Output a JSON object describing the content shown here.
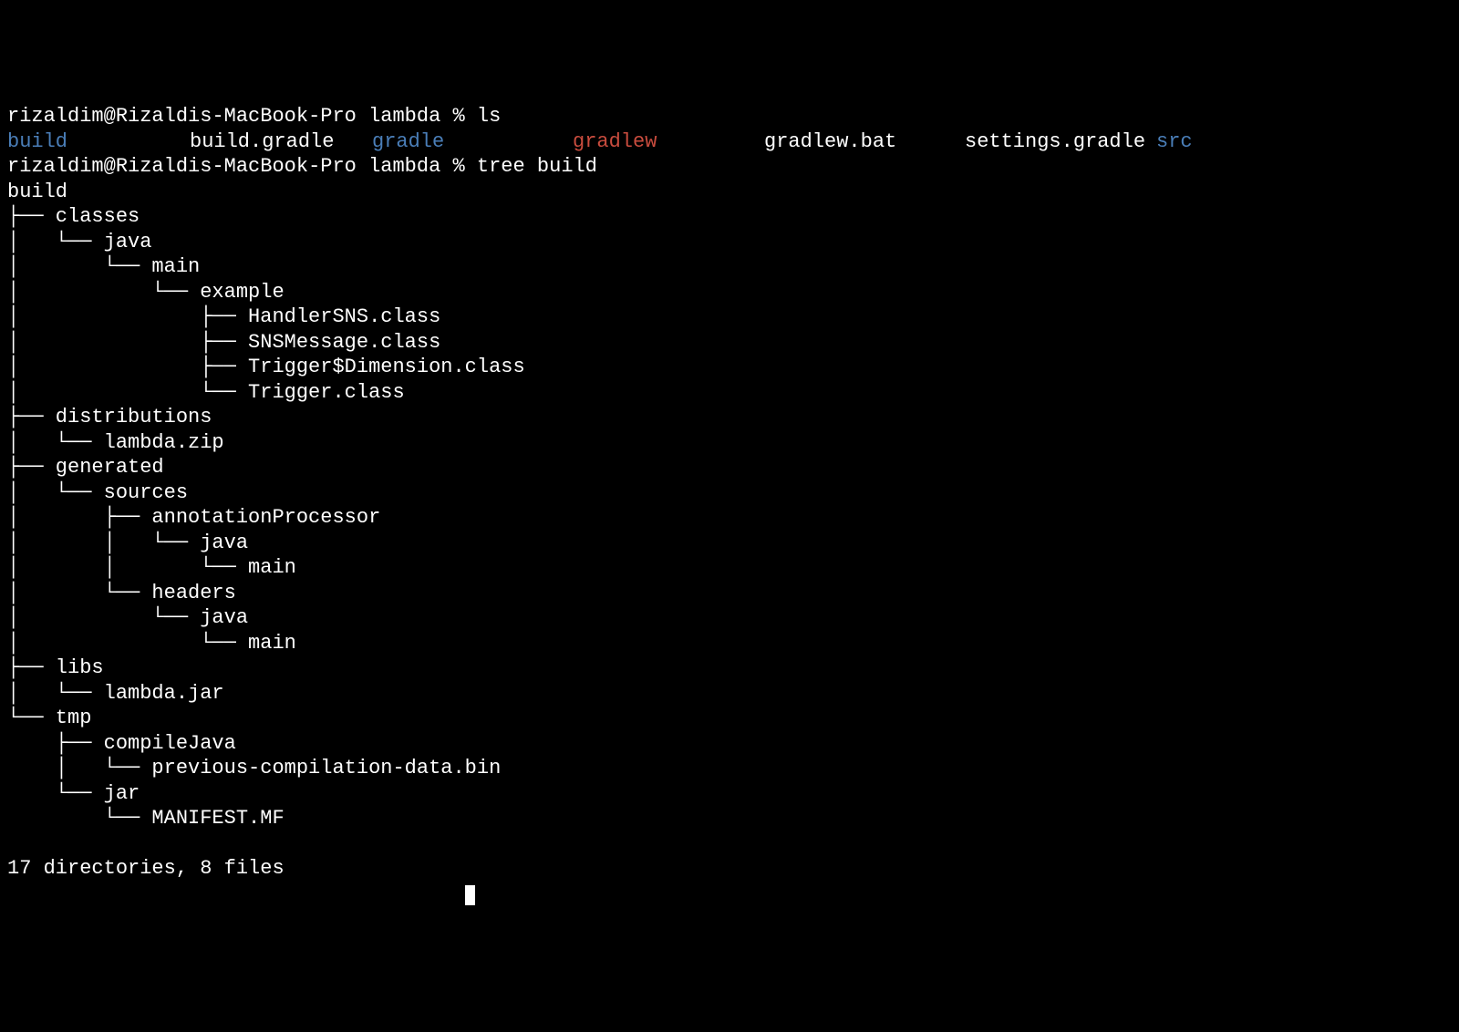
{
  "prompt": {
    "user": "rizaldim",
    "host": "Rizaldis-MacBook-Pro",
    "dir": "lambda",
    "symbol": "%"
  },
  "commands": {
    "ls": "ls",
    "tree": "tree build"
  },
  "ls_output": [
    {
      "name": "build",
      "type": "dir"
    },
    {
      "name": "build.gradle",
      "type": "file"
    },
    {
      "name": "gradle",
      "type": "dir"
    },
    {
      "name": "gradlew",
      "type": "exec"
    },
    {
      "name": "gradlew.bat",
      "type": "file"
    },
    {
      "name": "settings.gradle",
      "type": "file"
    },
    {
      "name": "src",
      "type": "dir"
    }
  ],
  "tree_lines": [
    "build",
    "├── classes",
    "│   └── java",
    "│       └── main",
    "│           └── example",
    "│               ├── HandlerSNS.class",
    "│               ├── SNSMessage.class",
    "│               ├── Trigger$Dimension.class",
    "│               └── Trigger.class",
    "├── distributions",
    "│   └── lambda.zip",
    "├── generated",
    "│   └── sources",
    "│       ├── annotationProcessor",
    "│       │   └── java",
    "│       │       └── main",
    "│       └── headers",
    "│           └── java",
    "│               └── main",
    "├── libs",
    "│   └── lambda.jar",
    "└── tmp",
    "    ├── compileJava",
    "    │   └── previous-compilation-data.bin",
    "    └── jar",
    "        └── MANIFEST.MF"
  ],
  "tree_summary": "17 directories, 8 files"
}
